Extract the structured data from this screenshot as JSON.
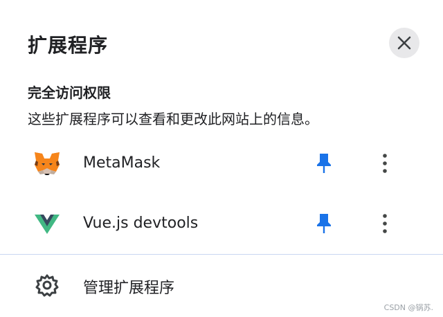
{
  "popup": {
    "title": "扩展程序",
    "close_icon": "close-icon"
  },
  "full_access": {
    "heading": "完全访问权限",
    "description": "这些扩展程序可以查看和更改此网站上的信息。"
  },
  "extensions": [
    {
      "name": "MetaMask",
      "icon": "metamask-fox-icon",
      "pinned": true,
      "pin_icon": "pin-icon",
      "menu_icon": "more-vertical-icon"
    },
    {
      "name": "Vue.js devtools",
      "icon": "vue-logo-icon",
      "pinned": true,
      "pin_icon": "pin-icon",
      "menu_icon": "more-vertical-icon"
    }
  ],
  "footer": {
    "manage_label": "管理扩展程序",
    "manage_icon": "gear-icon"
  },
  "watermark": "CSDN @锅苏.",
  "colors": {
    "pin_blue": "#1a73e8",
    "close_bg": "#e8e8ea",
    "divider": "#c9d6f2",
    "vue_green": "#41b883",
    "vue_dark": "#35495e",
    "metamask_orange": "#e2761b"
  }
}
